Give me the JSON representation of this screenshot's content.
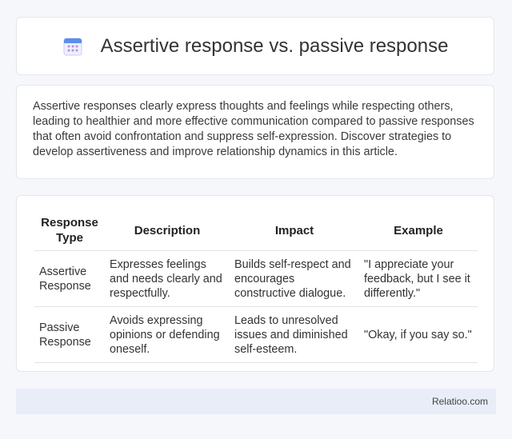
{
  "header": {
    "title": "Assertive response vs. passive response",
    "icon": "calendar-icon"
  },
  "intro": {
    "text": "Assertive responses clearly express thoughts and feelings while respecting others, leading to healthier and more effective communication compared to passive responses that often avoid confrontation and suppress self-expression. Discover strategies to develop assertiveness and improve relationship dynamics in this article."
  },
  "table": {
    "headers": [
      "Response Type",
      "Description",
      "Impact",
      "Example"
    ],
    "rows": [
      [
        "Assertive Response",
        "Expresses feelings and needs clearly and respectfully.",
        "Builds self-respect and encourages constructive dialogue.",
        "\"I appreciate your feedback, but I see it differently.\""
      ],
      [
        "Passive Response",
        "Avoids expressing opinions or defending oneself.",
        "Leads to unresolved issues and diminished self-esteem.",
        "\"Okay, if you say so.\""
      ]
    ]
  },
  "footer": {
    "brand": "Relatioo.com"
  },
  "colors": {
    "icon_blue": "#5b8def",
    "icon_purple": "#b58ee8",
    "footer_bg": "#e8edf7"
  }
}
